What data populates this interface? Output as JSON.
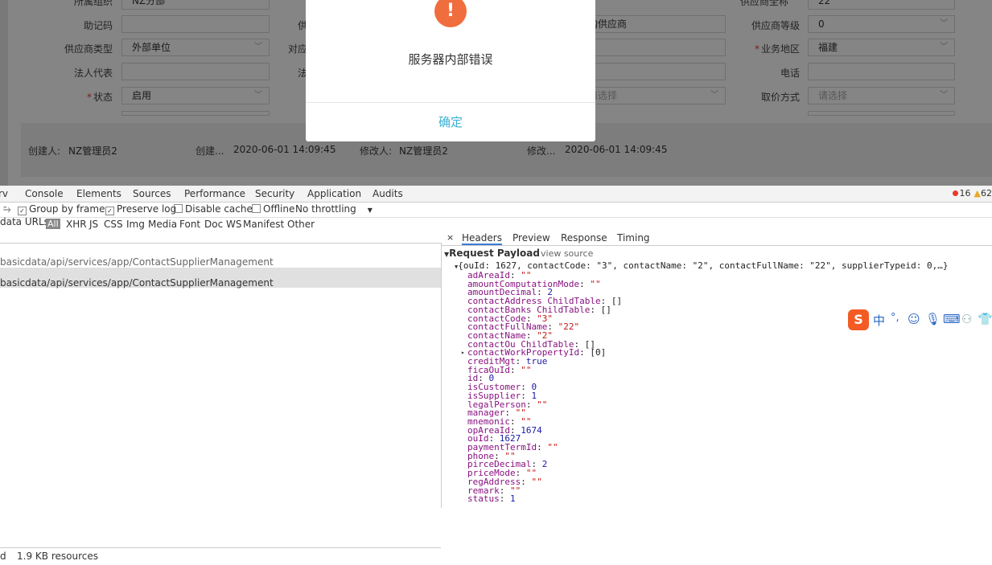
{
  "form": {
    "row0": {
      "label_left": "所属组织",
      "value_left": "NZ分部",
      "value_right": "22",
      "label_right": "供应商全称"
    },
    "row1": {
      "label1": "助记码",
      "label2": "供",
      "value3": "购供应商",
      "label4": "供应商等级",
      "value4": "0"
    },
    "row2": {
      "label1": "供应商类型",
      "value1": "外部单位",
      "label2": "对应",
      "label4": "业务地区",
      "value4": "福建"
    },
    "row3": {
      "label1": "法人代表",
      "label2": "法",
      "label4": "电话"
    },
    "row4": {
      "label1": "状态",
      "value1": "启用",
      "value3": "请选择",
      "label4": "取价方式",
      "value4": "请选择"
    }
  },
  "audit": {
    "creator_label": "创建人:",
    "creator": "NZ管理员2",
    "created_label": "创建...",
    "created": "2020-06-01 14:09:45",
    "modifier_label": "修改人:",
    "modifier": "NZ管理员2",
    "modified_label": "修改...",
    "modified": "2020-06-01 14:09:45"
  },
  "modal": {
    "icon": "!",
    "message": "服务器内部错误",
    "ok": "确定"
  },
  "devtools": {
    "tabs": [
      "rv",
      "Console",
      "Elements",
      "Sources",
      "Performance",
      "Security",
      "Application",
      "Audits"
    ],
    "errors": "16",
    "warnings": "62",
    "toolbar": {
      "group_by_frame": "Group by frame",
      "preserve_log": "Preserve log",
      "disable_cache": "Disable cache",
      "offline": "Offline",
      "throttling": "No throttling"
    },
    "filter": {
      "data_urls": "data URLs",
      "all": "All",
      "types": [
        "XHR",
        "JS",
        "CSS",
        "Img",
        "Media",
        "Font",
        "Doc",
        "WS",
        "Manifest",
        "Other"
      ]
    },
    "requests": [
      "basicdata/api/services/app/ContactSupplierManagement",
      "basicdata/api/services/app/ContactSupplierManagement"
    ],
    "footer": {
      "left": "d",
      "resources": "1.9 KB resources"
    },
    "detail_tabs": [
      "Headers",
      "Preview",
      "Response",
      "Timing"
    ],
    "payload_title": "Request Payload",
    "view_source": "view source",
    "payload_summary": "{ouId: 1627, contactCode: \"3\", contactName: \"2\", contactFullName: \"22\", supplierTypeid: 0,…}",
    "payload": [
      {
        "k": "adAreaId",
        "v": "\"\""
      },
      {
        "k": "amountComputationMode",
        "v": "\"\""
      },
      {
        "k": "amountDecimal",
        "v": "2"
      },
      {
        "k": "contactAddress ChildTable",
        "v": "[]"
      },
      {
        "k": "contactBanks ChildTable",
        "v": "[]"
      },
      {
        "k": "contactCode",
        "v": "\"3\""
      },
      {
        "k": "contactFullName",
        "v": "\"22\""
      },
      {
        "k": "contactName",
        "v": "\"2\""
      },
      {
        "k": "contactOu ChildTable",
        "v": "[]"
      },
      {
        "k": "contactWorkPropertyId",
        "v": "[0]"
      },
      {
        "k": "creditMgt",
        "v": "true"
      },
      {
        "k": "ficaOuId",
        "v": "\"\""
      },
      {
        "k": "id",
        "v": "0"
      },
      {
        "k": "isCustomer",
        "v": "0"
      },
      {
        "k": "isSupplier",
        "v": "1"
      },
      {
        "k": "legalPerson",
        "v": "\"\""
      },
      {
        "k": "manager",
        "v": "\"\""
      },
      {
        "k": "mnemonic",
        "v": "\"\""
      },
      {
        "k": "opAreaId",
        "v": "1674"
      },
      {
        "k": "ouId",
        "v": "1627"
      },
      {
        "k": "paymentTermId",
        "v": "\"\""
      },
      {
        "k": "phone",
        "v": "\"\""
      },
      {
        "k": "pirceDecimal",
        "v": "2"
      },
      {
        "k": "priceMode",
        "v": "\"\""
      },
      {
        "k": "regAddress",
        "v": "\"\""
      },
      {
        "k": "remark",
        "v": "\"\""
      },
      {
        "k": "status",
        "v": "1"
      }
    ]
  },
  "ime": {
    "logo": "S",
    "lang": "中",
    "punct": "°,"
  }
}
